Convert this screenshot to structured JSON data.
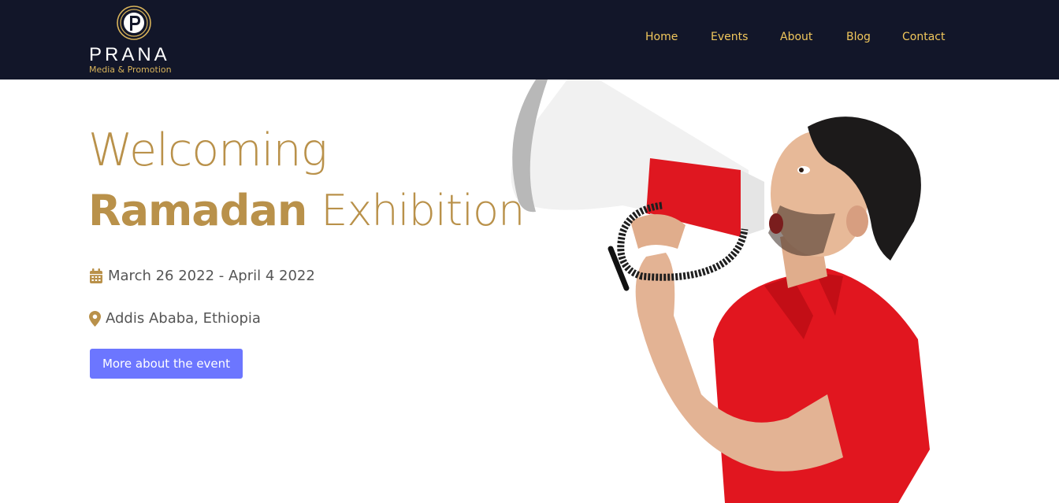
{
  "header": {
    "brand_name": "PRANA",
    "brand_tagline": "Media & Promotion",
    "nav": [
      {
        "label": "Home"
      },
      {
        "label": "Events"
      },
      {
        "label": "About"
      },
      {
        "label": "Blog"
      },
      {
        "label": "Contact"
      }
    ]
  },
  "hero": {
    "title_line1": "Welcoming",
    "title_bold": "Ramadan",
    "title_light": "Exhibition",
    "date": "March 26 2022 - April 4 2022",
    "location": "Addis Ababa, Ethiopia",
    "cta_label": "More about the event",
    "image": "man-shouting-into-megaphone"
  },
  "colors": {
    "navbar_bg": "#121629",
    "nav_link": "#f1c75c",
    "accent_gold": "#b9914a",
    "button_bg": "#6c76ff"
  }
}
